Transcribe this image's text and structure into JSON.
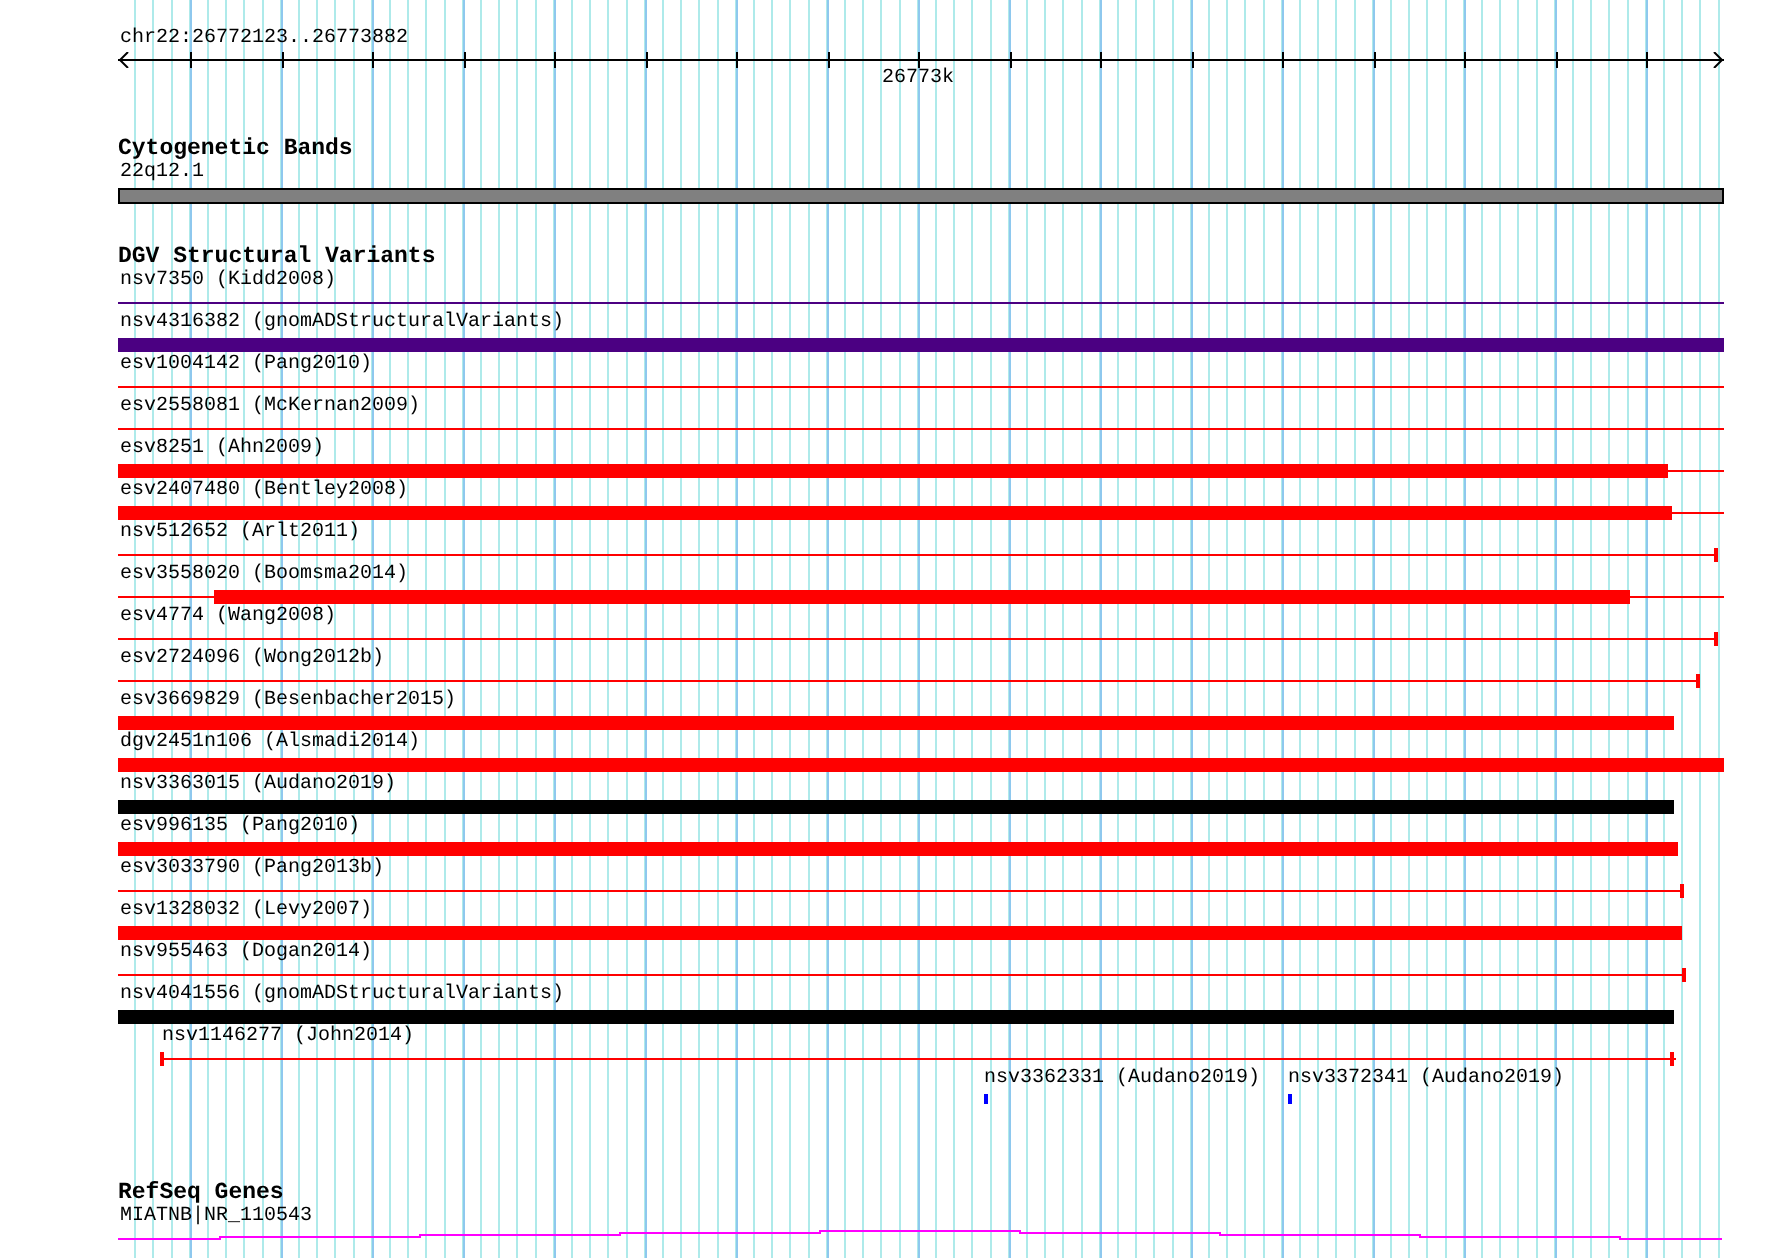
{
  "ruler": {
    "location": "chr22:26772123..26773882",
    "tick_label": "26773k"
  },
  "cytogenetic_bands": {
    "title": "Cytogenetic Bands",
    "band": "22q12.1"
  },
  "dgv_structural_variants": {
    "title": "DGV Structural Variants",
    "variants": [
      {
        "label": "nsv7350 (Kidd2008)",
        "color": "#4b0082",
        "kind": "line"
      },
      {
        "label": "nsv4316382 (gnomADStructuralVariants)",
        "color": "#4b0082",
        "kind": "bar"
      },
      {
        "label": "esv1004142 (Pang2010)",
        "color": "#ff0000",
        "kind": "line"
      },
      {
        "label": "esv2558081 (McKernan2009)",
        "color": "#ff0000",
        "kind": "line"
      },
      {
        "label": "esv8251 (Ahn2009)",
        "color": "#ff0000",
        "kind": "bar"
      },
      {
        "label": "esv2407480 (Bentley2008)",
        "color": "#ff0000",
        "kind": "bar"
      },
      {
        "label": "nsv512652 (Arlt2011)",
        "color": "#ff0000",
        "kind": "line"
      },
      {
        "label": "esv3558020 (Boomsma2014)",
        "color": "#ff0000",
        "kind": "bar"
      },
      {
        "label": "esv4774 (Wang2008)",
        "color": "#ff0000",
        "kind": "line"
      },
      {
        "label": "esv2724096 (Wong2012b)",
        "color": "#ff0000",
        "kind": "line"
      },
      {
        "label": "esv3669829 (Besenbacher2015)",
        "color": "#ff0000",
        "kind": "bar"
      },
      {
        "label": "dgv2451n106 (Alsmadi2014)",
        "color": "#ff0000",
        "kind": "bar"
      },
      {
        "label": "nsv3363015 (Audano2019)",
        "color": "#000000",
        "kind": "bar"
      },
      {
        "label": "esv996135 (Pang2010)",
        "color": "#ff0000",
        "kind": "bar"
      },
      {
        "label": "esv3033790 (Pang2013b)",
        "color": "#ff0000",
        "kind": "line"
      },
      {
        "label": "esv1328032 (Levy2007)",
        "color": "#ff0000",
        "kind": "bar"
      },
      {
        "label": "nsv955463 (Dogan2014)",
        "color": "#ff0000",
        "kind": "line"
      },
      {
        "label": "nsv4041556 (gnomADStructuralVariants)",
        "color": "#000000",
        "kind": "bar"
      },
      {
        "label": "nsv1146277 (John2014)",
        "color": "#ff0000",
        "kind": "line"
      },
      {
        "label": "nsv3362331 (Audano2019)",
        "color": "#0000ff",
        "kind": "point"
      },
      {
        "label": "nsv3372341 (Audano2019)",
        "color": "#0000ff",
        "kind": "point"
      }
    ]
  },
  "refseq_genes": {
    "title": "RefSeq Genes",
    "gene": "MIATNB|NR_110543"
  }
}
